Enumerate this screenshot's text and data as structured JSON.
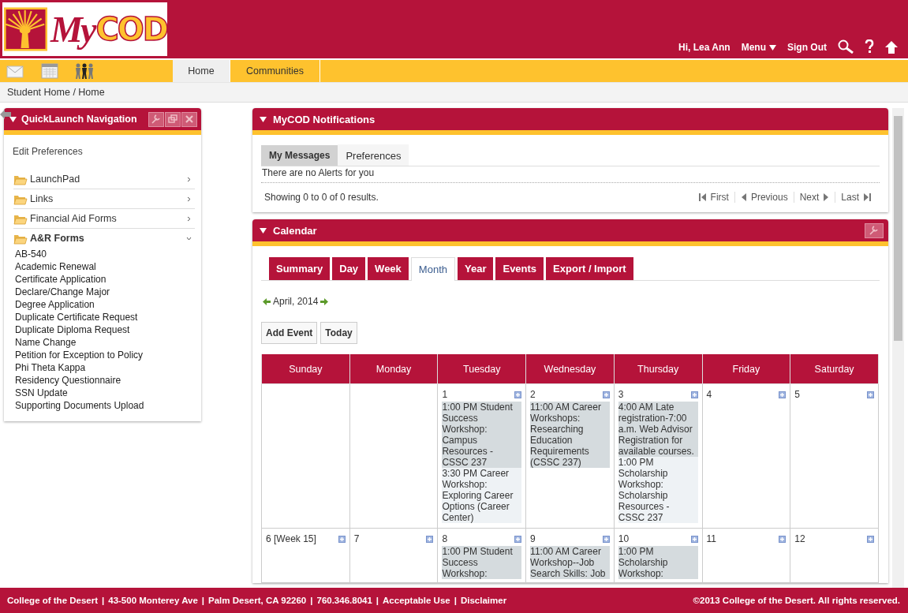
{
  "header": {
    "logo": {
      "parts": [
        "My",
        "COD"
      ]
    },
    "greeting": "Hi, Lea Ann",
    "menu": "Menu",
    "sign_out": "Sign Out"
  },
  "nav": {
    "tabs": [
      {
        "label": "Home",
        "selected": true
      },
      {
        "label": "Communities",
        "selected": false
      }
    ]
  },
  "breadcrumb": "Student Home / Home",
  "quicklaunch": {
    "title": "QuickLaunch Navigation",
    "edit_link": "Edit Preferences",
    "folders": [
      {
        "label": "LaunchPad",
        "expanded": false
      },
      {
        "label": "Links",
        "expanded": false
      },
      {
        "label": "Financial Aid Forms",
        "expanded": false
      },
      {
        "label": "A&R Forms",
        "expanded": true,
        "children": [
          "AB-540",
          "Academic Renewal",
          "Certificate Application",
          "Declare/Change Major",
          "Degree Application",
          "Duplicate Certificate Request",
          "Duplicate Diploma Request",
          "Name Change",
          "Petition for Exception to Policy",
          "Phi Theta Kappa",
          "Residency Questionnaire",
          "SSN Update",
          "Supporting Documents Upload"
        ]
      }
    ]
  },
  "notifications": {
    "title": "MyCOD Notifications",
    "tabs": [
      {
        "label": "My Messages",
        "selected": true
      },
      {
        "label": "Preferences",
        "selected": false
      }
    ],
    "message": "There are no Alerts for you",
    "results": "Showing 0 to 0 of 0 results.",
    "pager": [
      {
        "kind": "first",
        "label": "First"
      },
      {
        "kind": "previous",
        "label": "Previous"
      },
      {
        "kind": "next",
        "label": "Next"
      },
      {
        "kind": "last",
        "label": "Last"
      }
    ]
  },
  "calendar": {
    "title": "Calendar",
    "tabs": [
      {
        "label": "Summary",
        "selected": false
      },
      {
        "label": "Day",
        "selected": false
      },
      {
        "label": "Week",
        "selected": false
      },
      {
        "label": "Month",
        "selected": true
      },
      {
        "label": "Year",
        "selected": false
      },
      {
        "label": "Events",
        "selected": false
      },
      {
        "label": "Export / Import",
        "selected": false
      }
    ],
    "period": "April, 2014",
    "buttons": [
      "Add Event",
      "Today"
    ],
    "days": [
      "Sunday",
      "Monday",
      "Tuesday",
      "Wednesday",
      "Thursday",
      "Friday",
      "Saturday"
    ],
    "weeks": [
      [
        {
          "date": "1",
          "events": [
            "1:00 PM Student Success Workshop: Campus Resources - CSSC 237",
            "3:30 PM Career Workshop: Exploring Career Options (Career Center)"
          ]
        },
        {
          "date": "2",
          "events": [
            "11:00 AM Career Workshops: Researching Education Requirements (CSSC 237)"
          ]
        },
        {
          "date": "3",
          "events": [
            "4:00 AM Late registration-7:00 a.m. Web Advisor Registration for available courses.",
            "1:00 PM Scholarship Workshop: Scholarship Resources - CSSC 237"
          ]
        },
        {
          "date": "4"
        },
        {
          "date": "5"
        }
      ],
      [
        {
          "date": "6 [Week 15]"
        },
        {
          "date": "7"
        },
        {
          "date": "8",
          "events": [
            "1:00 PM Student Success Workshop:"
          ]
        },
        {
          "date": "9",
          "events": [
            "11:00 AM Career Workshop--Job Search Skills: Job"
          ]
        },
        {
          "date": "10",
          "events": [
            "1:00 PM Scholarship Workshop:"
          ]
        },
        {
          "date": "11"
        },
        {
          "date": "12"
        }
      ]
    ]
  },
  "footer": {
    "separator": "|",
    "items": [
      "College of the Desert",
      "43-500 Monterey Ave",
      "Palm Desert, CA 92260",
      "760.346.8041",
      "Acceptable Use",
      "Disclaimer"
    ],
    "copyright": "©2013 College of the Desert. All rights reserved."
  }
}
